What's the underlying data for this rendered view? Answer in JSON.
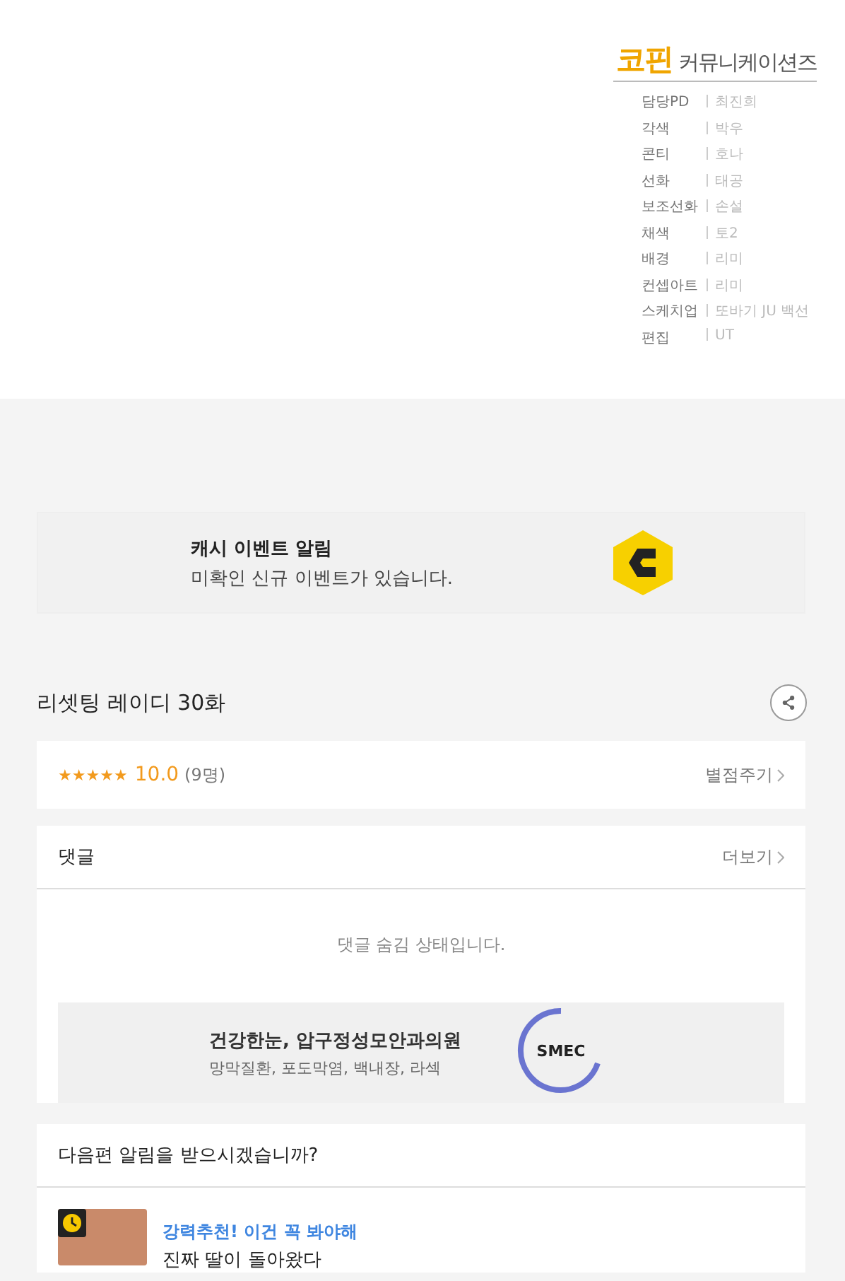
{
  "credits": {
    "studio_brand": "코핀",
    "studio_name": "커뮤니케이션즈",
    "roles": [
      {
        "role": "담당PD",
        "name": "최진희"
      },
      {
        "role": "각색",
        "name": "박우"
      },
      {
        "role": "콘티",
        "name": "호나"
      },
      {
        "role": "선화",
        "name": "태공"
      },
      {
        "role": "보조선화",
        "name": "손설"
      },
      {
        "role": "채색",
        "name": "토2"
      },
      {
        "role": "배경",
        "name": "리미"
      },
      {
        "role": "컨셉아트",
        "name": "리미"
      },
      {
        "role": "스케치업",
        "name": "또바기 JU 백선"
      },
      {
        "role": "편집",
        "name": "UT"
      }
    ]
  },
  "cash_banner": {
    "title": "캐시 이벤트 알림",
    "message": "미확인 신규 이벤트가 있습니다."
  },
  "episode": {
    "title": "리셋팅 레이디 30화"
  },
  "rating": {
    "stars": 5,
    "score": "10.0",
    "count": "(9명)",
    "action": "별점주기"
  },
  "comments": {
    "title": "댓글",
    "more": "더보기",
    "notice": "댓글 숨김 상태입니다.",
    "ad": {
      "headline": "건강한눈, 압구정성모안과의원",
      "subline": "망막질환, 포도막염, 백내장, 라섹",
      "logo_text": "SMEC"
    }
  },
  "next_alert": {
    "question": "다음편 알림을 받으시겠습니까?",
    "items": [
      {
        "tag": "강력추천! 이건 꼭 봐야해",
        "title": "진짜 딸이 돌아왔다"
      }
    ]
  }
}
